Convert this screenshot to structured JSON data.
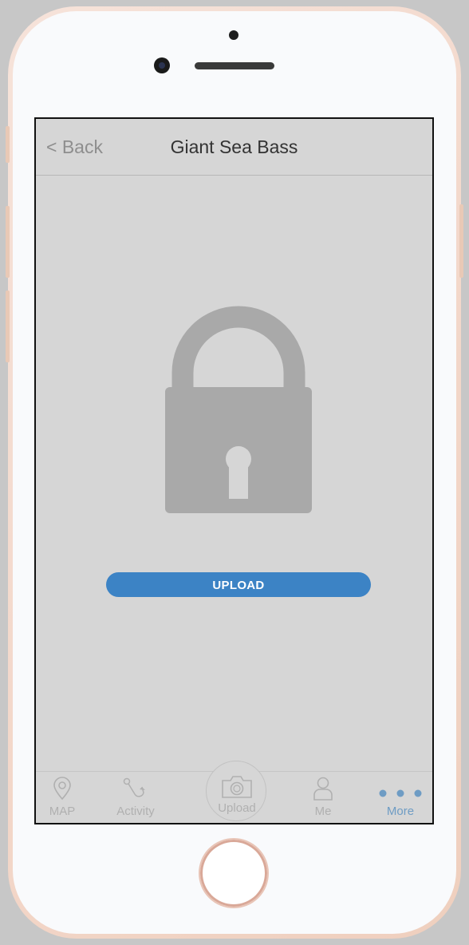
{
  "header": {
    "back_label": "< Back",
    "title": "Giant Sea Bass"
  },
  "main": {
    "lock_icon": "padlock-icon",
    "upload_button_label": "UPLOAD"
  },
  "tabbar": {
    "items": [
      {
        "label": "MAP",
        "icon": "map-pin-icon",
        "active": false
      },
      {
        "label": "Activity",
        "icon": "fishing-hook-icon",
        "active": false
      },
      {
        "label": "Upload",
        "icon": "camera-icon",
        "active": false
      },
      {
        "label": "Me",
        "icon": "person-icon",
        "active": false
      },
      {
        "label": "More",
        "icon": "more-dots-icon",
        "active": true
      }
    ]
  },
  "colors": {
    "accent": "#3c83c5",
    "screen_bg": "#d6d6d6",
    "lock": "#a9a9a9",
    "tab_inactive": "#b0b0b0",
    "tab_active": "#6e9cc4"
  }
}
